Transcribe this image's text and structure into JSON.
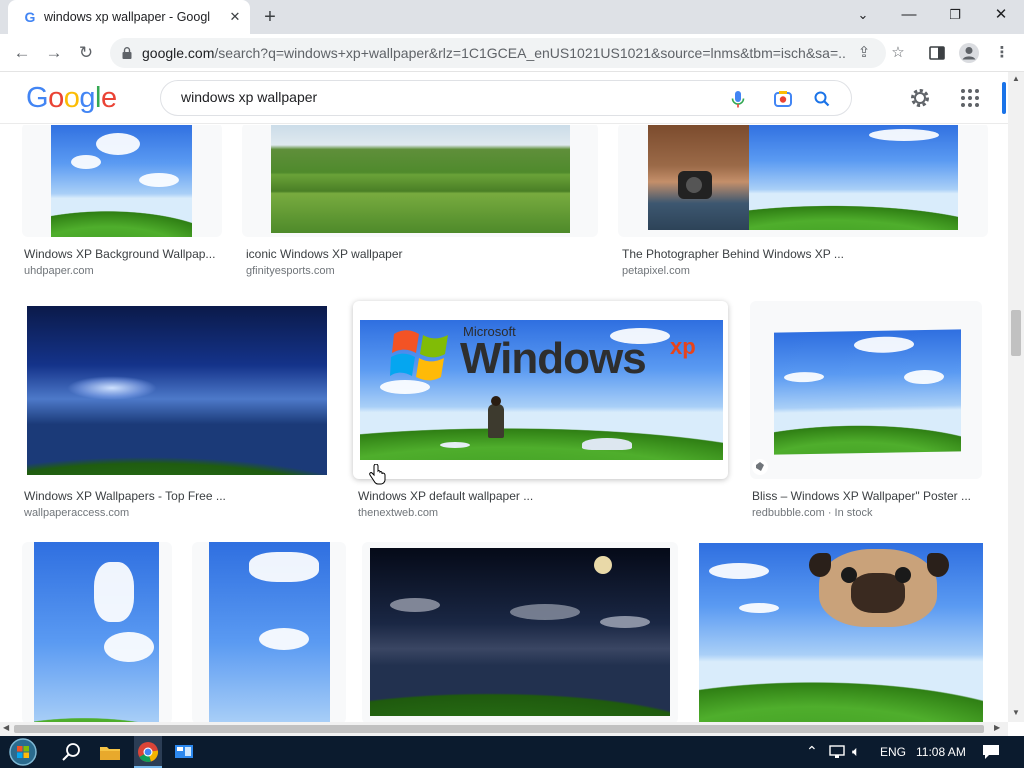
{
  "browser": {
    "tab_title": "windows xp wallpaper - Google Search",
    "tab_favicon": "G",
    "new_tab_label": "+",
    "url_host": "google.com",
    "url_rest": "/search?q=windows+xp+wallpaper&rlz=1C1GCEA_enUS1021US1021&source=lnms&tbm=isch&sa=...",
    "window_controls": [
      "chevron-down-icon",
      "minimize-icon",
      "restore-icon",
      "close-icon"
    ]
  },
  "google": {
    "logo_letters": [
      "G",
      "o",
      "o",
      "g",
      "l",
      "e"
    ],
    "search_value": "windows xp wallpaper",
    "colors": {
      "blue": "#4285f4",
      "red": "#ea4335",
      "yellow": "#fbbc05",
      "green": "#34a853",
      "accent": "#1a73e8"
    }
  },
  "results": [
    {
      "title": "Windows XP Background Wallpap...",
      "source": "uhdpaper.com"
    },
    {
      "title": "iconic Windows XP wallpaper",
      "source": "gfinityesports.com"
    },
    {
      "title": "The Photographer Behind Windows XP ...",
      "source": "petapixel.com"
    },
    {
      "title": "Windows XP Wallpapers - Top Free ...",
      "source": "wallpaperaccess.com"
    },
    {
      "title": "Windows XP default wallpaper ...",
      "source": "thenextweb.com",
      "overlay_brand": "Microsoft",
      "overlay_title": "Windows",
      "overlay_sup": "xp"
    },
    {
      "title": "Bliss – Windows XP Wallpaper\" Poster ...",
      "source": "redbubble.com · In stock"
    },
    {
      "title": "",
      "source": ""
    },
    {
      "title": "",
      "source": ""
    },
    {
      "title": "",
      "source": ""
    },
    {
      "title": "",
      "source": ""
    }
  ],
  "taskbar": {
    "language": "ENG",
    "time": "11:08 AM",
    "icons": [
      "start-orb-icon",
      "search-icon",
      "file-explorer-icon",
      "chrome-icon",
      "control-panel-icon"
    ]
  }
}
